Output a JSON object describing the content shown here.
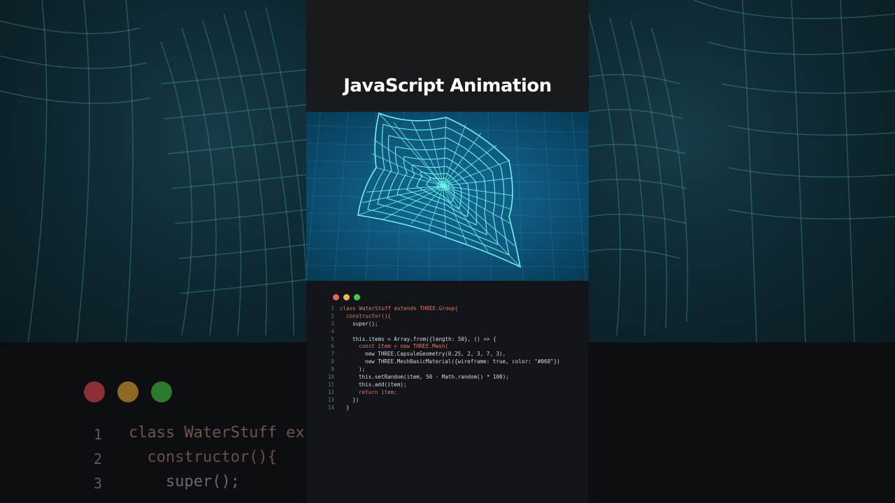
{
  "title": "JavaScript Animation",
  "colors": {
    "dot_red": "#ec5f5f",
    "dot_yellow": "#f1b73e",
    "dot_green": "#49c94a",
    "mesh": "#5ff2e6",
    "scene_bg": "#0d4d6d"
  },
  "code": [
    {
      "n": "1",
      "text": "class WaterStuff extends THREE.Group{",
      "indent": 0
    },
    {
      "n": "2",
      "text": "constructor(){",
      "indent": 1
    },
    {
      "n": "3",
      "text": "super();",
      "indent": 2
    },
    {
      "n": "4",
      "text": "",
      "indent": 0
    },
    {
      "n": "5",
      "text": "this.items = Array.from({length: 50}, () => {",
      "indent": 2
    },
    {
      "n": "6",
      "text": "const item = new THREE.Mesh(",
      "indent": 3
    },
    {
      "n": "7",
      "text": "new THREE.CapsuleGeometry(0.25, 2, 3, 7, 3),",
      "indent": 4
    },
    {
      "n": "8",
      "text": "new THREE.MeshBasicMaterial({wireframe: true, color: \"#068\"})",
      "indent": 4
    },
    {
      "n": "9",
      "text": ");",
      "indent": 3
    },
    {
      "n": "10",
      "text": "this.setRandom(item, 50 - Math.random() * 100);",
      "indent": 3
    },
    {
      "n": "11",
      "text": "this.add(item);",
      "indent": 3
    },
    {
      "n": "12",
      "text": "return item;",
      "indent": 3
    },
    {
      "n": "13",
      "text": "})",
      "indent": 2
    },
    {
      "n": "14",
      "text": "}",
      "indent": 1
    }
  ],
  "bg_code": [
    {
      "n": "1",
      "text": "class WaterStuff ex"
    },
    {
      "n": "2",
      "text": "  constructor(){"
    },
    {
      "n": "3",
      "text": "    super();"
    }
  ]
}
